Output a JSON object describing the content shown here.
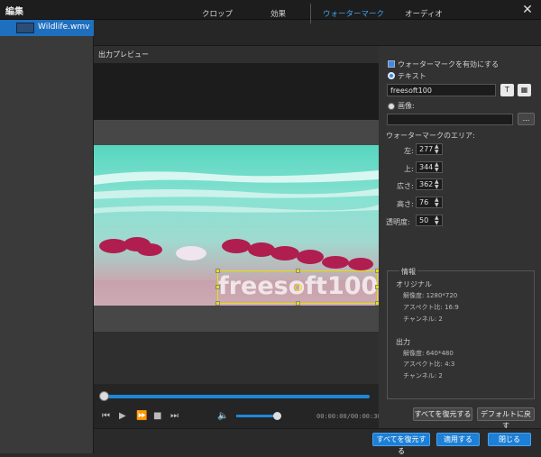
{
  "window": {
    "title": "編集",
    "close": "✕"
  },
  "sidebar": {
    "items": [
      {
        "label": "Wildlife.wmv",
        "selected": true
      }
    ]
  },
  "tabs": [
    {
      "label": "クロップ",
      "active": false
    },
    {
      "label": "効果",
      "active": false
    },
    {
      "label": "ウォーターマーク",
      "active": true
    },
    {
      "label": "オーディオ",
      "active": false
    }
  ],
  "preview": {
    "label": "出力プレビュー",
    "watermark_text": "freesoft100"
  },
  "player": {
    "time": "00:00:00/00:00:30",
    "icons": [
      "prev-icon",
      "play-icon",
      "fast-forward-icon",
      "stop-icon",
      "next-icon",
      "volume-icon"
    ],
    "progress": 0.0,
    "volume": 0.8
  },
  "watermark": {
    "enable_label": "ウォーターマークを有効にする",
    "enabled": true,
    "text_option": "テキスト",
    "text_value": "freesoft100",
    "text_btn": "T",
    "image_option": "画像:",
    "image_btn": "...",
    "area_label": "ウォーターマークのエリア:",
    "fields": [
      {
        "label": "左:",
        "value": "277"
      },
      {
        "label": "上:",
        "value": "344"
      },
      {
        "label": "広さ:",
        "value": "362"
      },
      {
        "label": "高さ:",
        "value": "76"
      },
      {
        "label": "透明度:",
        "value": "50"
      }
    ]
  },
  "info": {
    "title": "情報",
    "original": {
      "heading": "オリジナル",
      "resolution": "解像度: 1280*720",
      "aspect": "アスペクト比: 16:9",
      "channels": "チャンネル: 2"
    },
    "output": {
      "heading": "出力",
      "resolution": "解像度: 640*480",
      "aspect": "アスペクト比: 4:3",
      "channels": "チャンネル: 2"
    }
  },
  "buttons": {
    "restore_all_right": "すべてを復元する",
    "default": "デフォルトに戻す",
    "restore_all": "すべてを復元する",
    "apply": "適用する",
    "close": "閉じる"
  },
  "colors": {
    "accent": "#1d7fd6",
    "watermark_box": "#e8e000",
    "background": "#2b2b2b"
  }
}
